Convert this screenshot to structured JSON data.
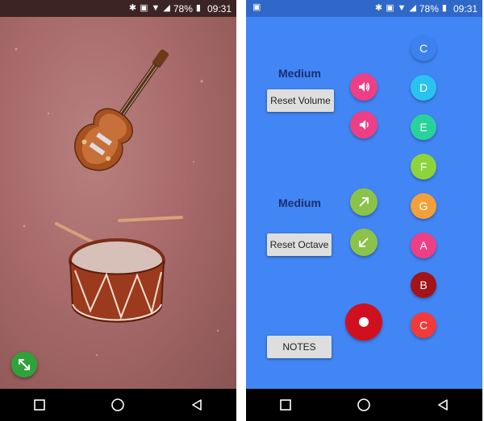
{
  "status_bar": {
    "battery": "78%",
    "time": "09:31"
  },
  "left_screen": {
    "fab_icon": "expand-arrows-icon"
  },
  "right_screen": {
    "volume": {
      "level_label": "Medium",
      "reset_label": "Reset Volume",
      "up_icon": "volume-up-icon",
      "down_icon": "volume-down-icon",
      "color": "#ee3f86"
    },
    "octave": {
      "level_label": "Medium",
      "reset_label": "Reset Octave",
      "up_icon": "arrow-up-right-icon",
      "down_icon": "arrow-down-left-icon",
      "color": "#8bc34a"
    },
    "record_icon": "record-icon",
    "notes_label": "NOTES",
    "notes": [
      {
        "label": "C",
        "color": "#3b82f0"
      },
      {
        "label": "D",
        "color": "#28c4ef"
      },
      {
        "label": "E",
        "color": "#2ad29b"
      },
      {
        "label": "F",
        "color": "#8dd43c"
      },
      {
        "label": "G",
        "color": "#f2a13a"
      },
      {
        "label": "A",
        "color": "#ee3f86"
      },
      {
        "label": "B",
        "color": "#a3131a"
      },
      {
        "label": "C",
        "color": "#f33a3a"
      }
    ]
  }
}
